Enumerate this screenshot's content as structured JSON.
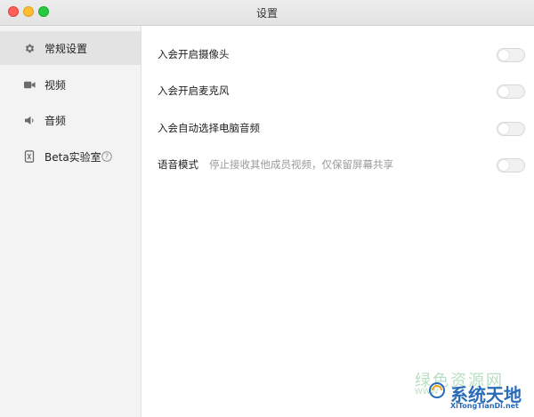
{
  "window": {
    "title": "设置"
  },
  "sidebar": {
    "items": [
      {
        "label": "常规设置",
        "icon": "gear-icon",
        "active": true
      },
      {
        "label": "视频",
        "icon": "video-camera-icon",
        "active": false
      },
      {
        "label": "音频",
        "icon": "speaker-icon",
        "active": false
      },
      {
        "label": "Beta实验室",
        "icon": "flask-icon",
        "active": false,
        "badge_icon": "help-circle-icon"
      }
    ]
  },
  "settings": [
    {
      "label": "入会开启摄像头",
      "enabled": false
    },
    {
      "label": "入会开启麦克风",
      "enabled": false
    },
    {
      "label": "入会自动选择电脑音频",
      "enabled": false
    },
    {
      "label": "语音模式",
      "description": "停止接收其他成员视频，仅保留屏幕共享",
      "enabled": false
    }
  ],
  "watermark": {
    "faded_text": "绿色资源网",
    "faded_sub": "WWW",
    "main_text": "系统天地",
    "url": "XiTongTianDi.net"
  },
  "colors": {
    "sidebar_bg": "#f3f3f3",
    "active_item_bg": "#e3e3e3",
    "toggle_off_bg": "#f1f1f1",
    "watermark_blue": "#2a6bb8"
  }
}
